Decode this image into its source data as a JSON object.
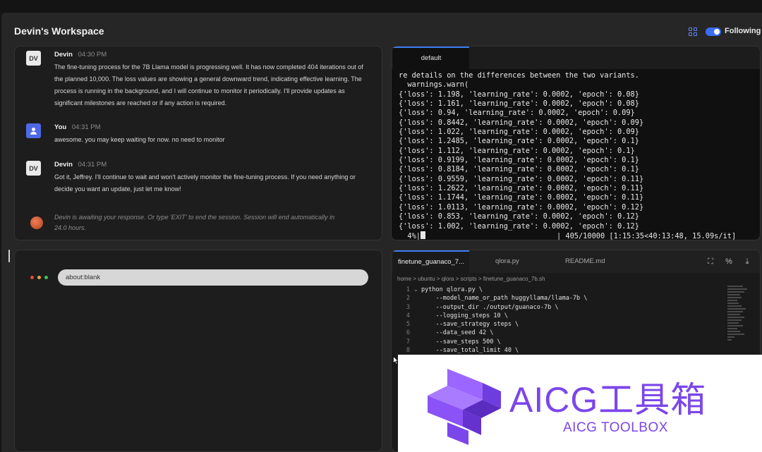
{
  "header": {
    "title": "Devin's Workspace",
    "following_label": "Following"
  },
  "chat": {
    "messages": [
      {
        "avatar": "DV",
        "author": "Devin",
        "time": "04:30 PM",
        "text": "The fine-tuning process for the 7B Llama model is progressing well. It has now completed 404 iterations out of the planned 10,000. The loss values are showing a general downward trend, indicating effective learning. The process is running in the background, and I will continue to monitor it periodically. I'll provide updates as significant milestones are reached or if any action is required."
      },
      {
        "avatar": "user-icon",
        "author": "You",
        "time": "04:31 PM",
        "text": "awesome. you may keep waiting for now. no need to monitor"
      },
      {
        "avatar": "DV",
        "author": "Devin",
        "time": "04:31 PM",
        "text": "Got it, Jeffrey. I'll continue to wait and won't actively monitor the fine-tuning process. If you need anything or decide you want an update, just let me know!"
      }
    ],
    "status": "Devin is awaiting your response. Or type 'EXIT' to end the session. Session will end automatically in 24.0 hours."
  },
  "browser": {
    "url": "about:blank",
    "dot_colors": [
      "#e5493a",
      "#e0a33a",
      "#3ec24f"
    ]
  },
  "terminal": {
    "tab_label": "default",
    "lines": [
      "re details on the differences between the two variants.",
      "  warnings.warn(",
      "{'loss': 1.198, 'learning_rate': 0.0002, 'epoch': 0.08}",
      "{'loss': 1.161, 'learning_rate': 0.0002, 'epoch': 0.08}",
      "{'loss': 0.94, 'learning_rate': 0.0002, 'epoch': 0.09}",
      "{'loss': 0.8442, 'learning_rate': 0.0002, 'epoch': 0.09}",
      "{'loss': 1.022, 'learning_rate': 0.0002, 'epoch': 0.09}",
      "{'loss': 1.2485, 'learning_rate': 0.0002, 'epoch': 0.1}",
      "{'loss': 1.112, 'learning_rate': 0.0002, 'epoch': 0.1}",
      "{'loss': 0.9199, 'learning_rate': 0.0002, 'epoch': 0.1}",
      "{'loss': 0.8184, 'learning_rate': 0.0002, 'epoch': 0.1}",
      "{'loss': 0.9559, 'learning_rate': 0.0002, 'epoch': 0.11}",
      "{'loss': 1.2622, 'learning_rate': 0.0002, 'epoch': 0.11}",
      "{'loss': 1.1744, 'learning_rate': 0.0002, 'epoch': 0.11}",
      "{'loss': 1.0113, 'learning_rate': 0.0002, 'epoch': 0.12}",
      "{'loss': 0.853, 'learning_rate': 0.0002, 'epoch': 0.12}",
      "{'loss': 1.002, 'learning_rate': 0.0002, 'epoch': 0.12}"
    ],
    "progress_prefix": "  4%|",
    "progress_suffix": "                              | 405/10000 [1:15:35<40:13:48, 15.09s/it]"
  },
  "editor": {
    "tabs": [
      "finetune_guanaco_7b.sh",
      "qlora.py",
      "README.md"
    ],
    "active_tab_display": "finetune_guanaco_7...",
    "breadcrumb": "home > ubuntu > qlora > scripts > finetune_guanaco_7b.sh",
    "line_numbers": [
      "1",
      "2",
      "3",
      "4",
      "5",
      "6",
      "7",
      "8"
    ],
    "code": [
      "python qlora.py \\",
      "    --model_name_or_path huggyllama/llama-7b \\",
      "    --output_dir ./output/guanaco-7b \\",
      "    --logging_steps 10 \\",
      "    --save_strategy steps \\",
      "    --data_seed 42 \\",
      "    --save_steps 500 \\",
      "    --save_total_limit 40 \\"
    ],
    "action_icons": [
      "expand-icon",
      "diff-icon",
      "download-icon"
    ]
  },
  "watermark": {
    "title": "AICG工具箱",
    "subtitle": "AICG TOOLBOX",
    "color": "#7b46ea"
  },
  "colors": {
    "accent": "#3d7cf0",
    "background": "#262626"
  }
}
